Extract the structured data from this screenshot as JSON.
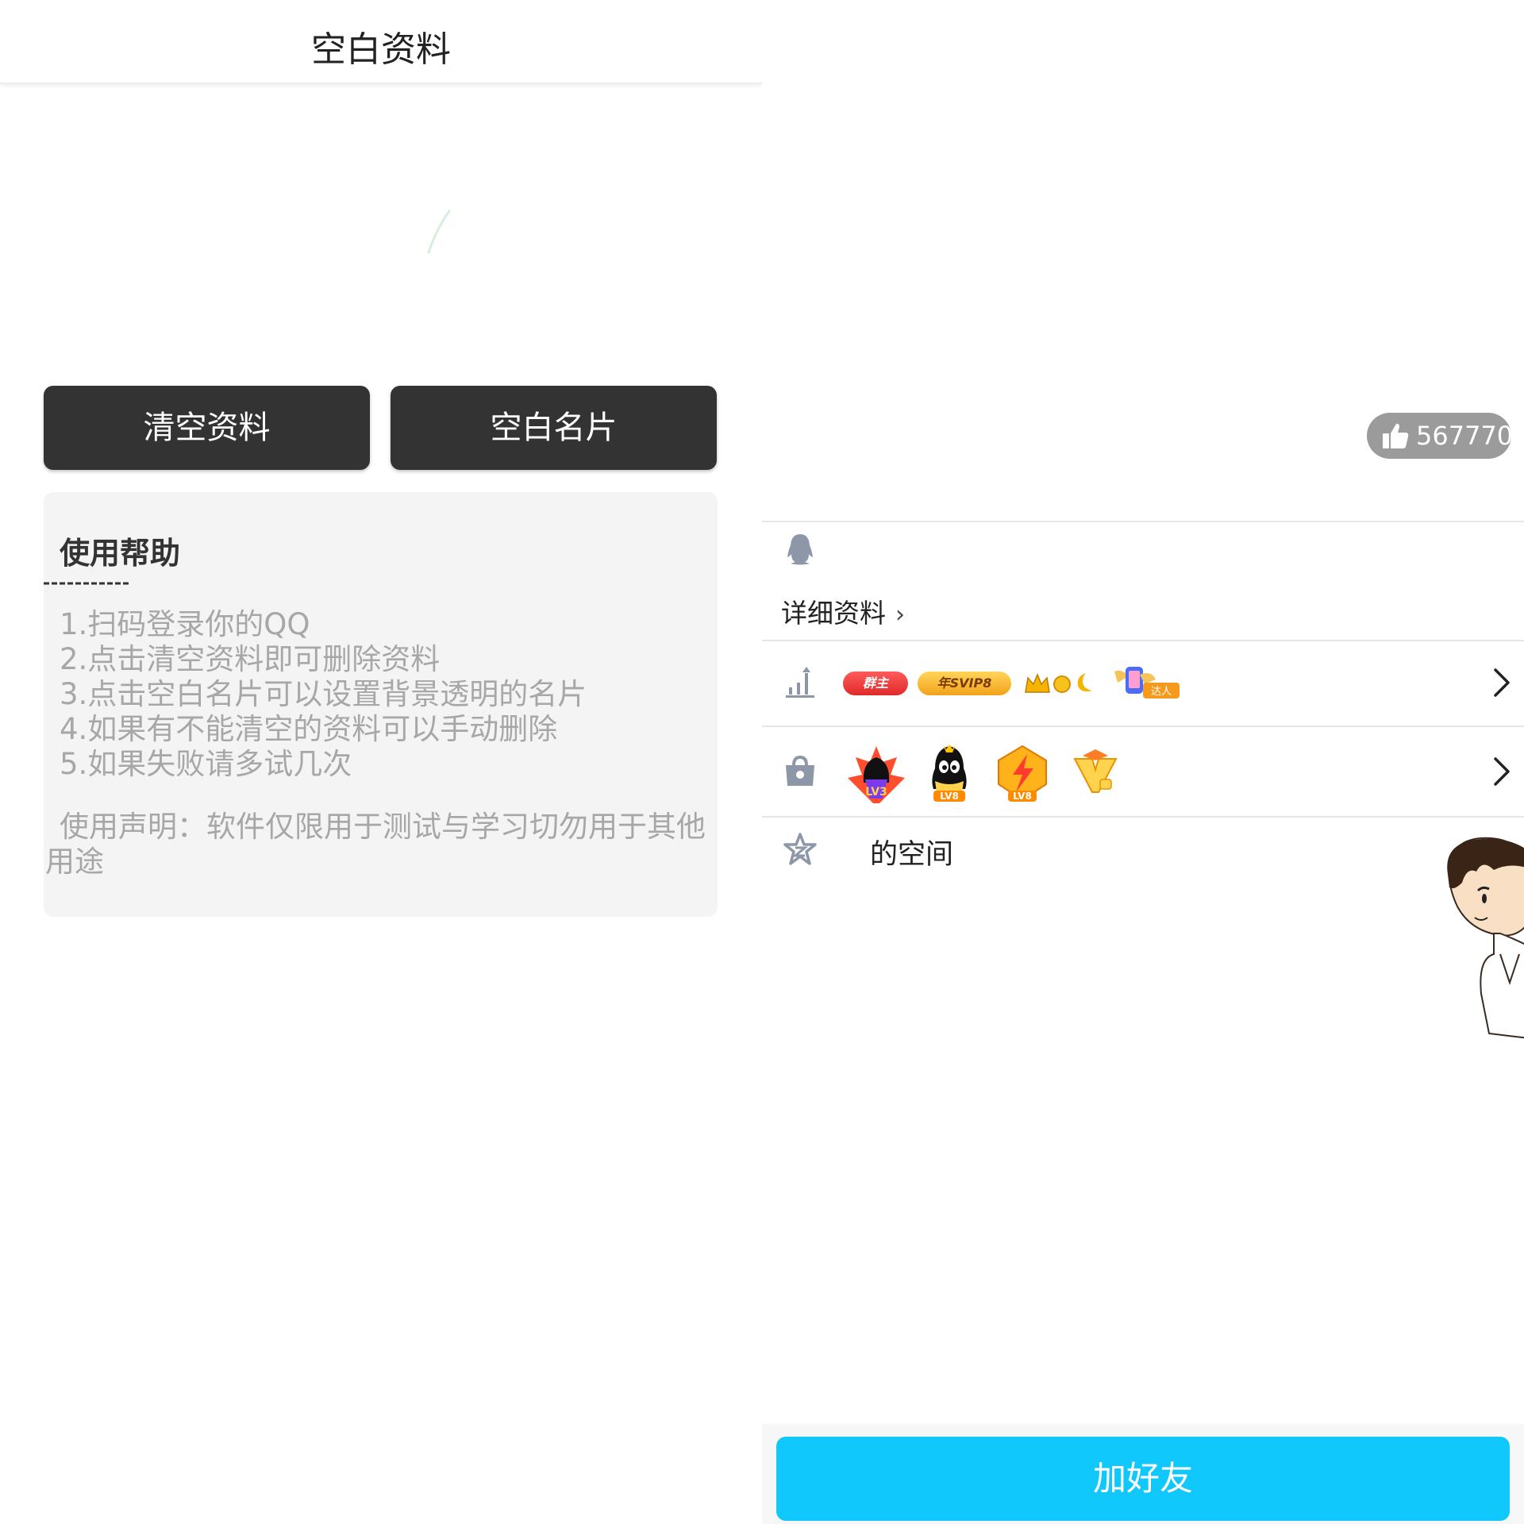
{
  "left": {
    "header_title": "空白资料",
    "buttons": {
      "clear_profile": "清空资料",
      "blank_card": "空白名片"
    },
    "help": {
      "title": "使用帮助",
      "separator": "----------",
      "steps": [
        "1.扫码登录你的QQ",
        "2.点击清空资料即可删除资料",
        "3.点击空白名片可以设置背景透明的名片",
        "4.如果有不能清空的资料可以手动删除",
        "5.如果失败请多试几次"
      ],
      "declaration": "使用声明：软件仅限用于测试与学习切勿用于其他用途"
    }
  },
  "right": {
    "likes": {
      "icon": "thumbs-up-icon",
      "count": "567770"
    },
    "qq_icon": "penguin-icon",
    "detail_link": "详细资料",
    "badges": {
      "owner": "群主",
      "svip": "年SVIP8"
    },
    "space_label": "的空间",
    "add_friend": "加好友",
    "colors": {
      "accent": "#10c8fc",
      "dark_button": "#333333",
      "help_bg": "#f4f4f4",
      "help_text": "#a7a7a7",
      "likes_bg": "#9b9b9b"
    }
  }
}
